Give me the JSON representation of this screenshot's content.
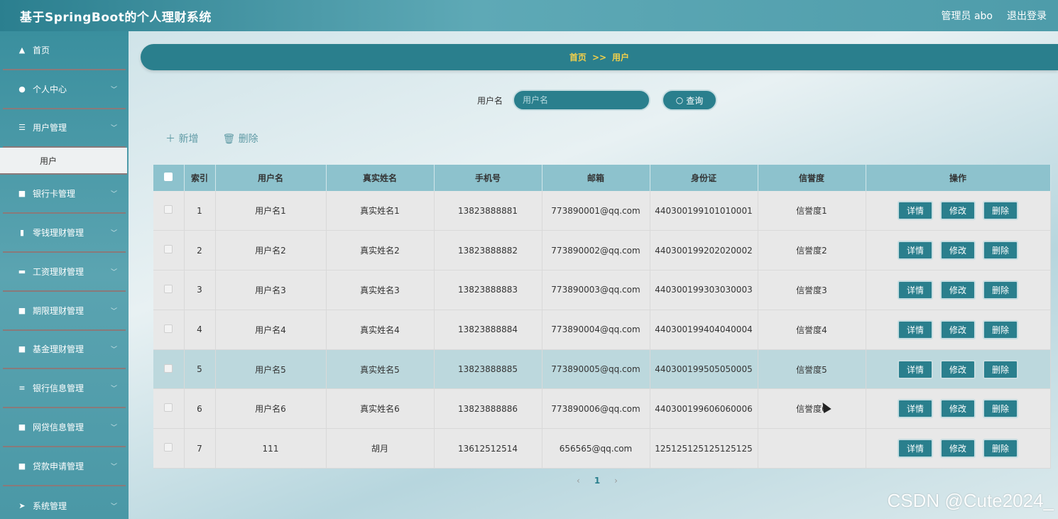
{
  "header": {
    "title": "基于SpringBoot的个人理财系统",
    "user": "管理员 abo",
    "logout": "退出登录"
  },
  "sidebar": {
    "items": [
      {
        "label": "首页",
        "icon": "home-icon"
      },
      {
        "label": "个人中心",
        "icon": "user-icon"
      },
      {
        "label": "用户管理",
        "icon": "sliders-icon"
      },
      {
        "label": "银行卡管理",
        "icon": "grid-icon"
      },
      {
        "label": "零钱理财管理",
        "icon": "clipboard-icon"
      },
      {
        "label": "工资理财管理",
        "icon": "ticket-icon"
      },
      {
        "label": "期限理财管理",
        "icon": "grid-icon"
      },
      {
        "label": "基金理财管理",
        "icon": "grid-icon"
      },
      {
        "label": "银行信息管理",
        "icon": "list-icon"
      },
      {
        "label": "网贷信息管理",
        "icon": "grid-icon"
      },
      {
        "label": "贷款申请管理",
        "icon": "grid-icon"
      },
      {
        "label": "系统管理",
        "icon": "send-icon"
      }
    ],
    "subitem": "用户"
  },
  "breadcrumb": {
    "home": "首页",
    "sep": ">>",
    "current": "用户"
  },
  "search": {
    "label": "用户名",
    "placeholder": "用户名",
    "button": "查询"
  },
  "toolbar": {
    "add": "新增",
    "delete": "删除"
  },
  "table": {
    "columns": [
      "索引",
      "用户名",
      "真实姓名",
      "手机号",
      "邮箱",
      "身份证",
      "信誉度",
      "操作"
    ],
    "rows": [
      {
        "index": "1",
        "username": "用户名1",
        "realname": "真实姓名1",
        "phone": "13823888881",
        "email": "773890001@qq.com",
        "idcard": "440300199101010001",
        "credit": "信誉度1"
      },
      {
        "index": "2",
        "username": "用户名2",
        "realname": "真实姓名2",
        "phone": "13823888882",
        "email": "773890002@qq.com",
        "idcard": "440300199202020002",
        "credit": "信誉度2"
      },
      {
        "index": "3",
        "username": "用户名3",
        "realname": "真实姓名3",
        "phone": "13823888883",
        "email": "773890003@qq.com",
        "idcard": "440300199303030003",
        "credit": "信誉度3"
      },
      {
        "index": "4",
        "username": "用户名4",
        "realname": "真实姓名4",
        "phone": "13823888884",
        "email": "773890004@qq.com",
        "idcard": "440300199404040004",
        "credit": "信誉度4"
      },
      {
        "index": "5",
        "username": "用户名5",
        "realname": "真实姓名5",
        "phone": "13823888885",
        "email": "773890005@qq.com",
        "idcard": "440300199505050005",
        "credit": "信誉度5"
      },
      {
        "index": "6",
        "username": "用户名6",
        "realname": "真实姓名6",
        "phone": "13823888886",
        "email": "773890006@qq.com",
        "idcard": "440300199606060006",
        "credit": "信誉度6"
      },
      {
        "index": "7",
        "username": "111",
        "realname": "胡月",
        "phone": "13612512514",
        "email": "656565@qq.com",
        "idcard": "125125125125125125",
        "credit": ""
      }
    ],
    "actions": {
      "detail": "详情",
      "edit": "修改",
      "remove": "删除"
    }
  },
  "pagination": {
    "prev": "‹",
    "current": "1",
    "next": "›"
  },
  "watermark": "CSDN @Cute2024_",
  "colors": {
    "accent": "#2a7f8d",
    "breadcrumb_text": "#f3d04a",
    "table_header": "#8dc2cd"
  }
}
